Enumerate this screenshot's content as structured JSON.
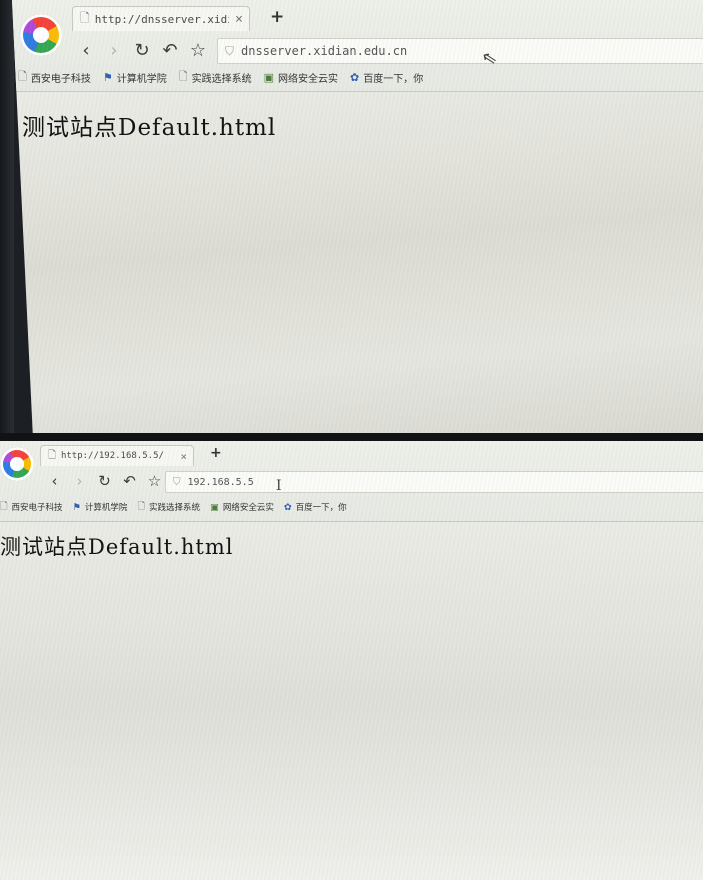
{
  "screenshots": [
    {
      "tab_title": "http://dnsserver.xidian.",
      "address": "dnsserver.xidian.edu.cn",
      "page_text": "测试站点Default.html",
      "cursor_icon": "arrow-cursor-icon"
    },
    {
      "tab_title": "http://192.168.5.5/",
      "address": "192.168.5.5",
      "page_text": "测试站点Default.html",
      "cursor_icon": "text-cursor-icon"
    }
  ],
  "tab_close_glyph": "×",
  "new_tab_glyph": "+",
  "bookmarks": [
    {
      "label": "西安电子科技",
      "icon": "page-icon"
    },
    {
      "label": "计算机学院",
      "icon": "pin-icon"
    },
    {
      "label": "实践选择系统",
      "icon": "page-icon"
    },
    {
      "label": "网络安全云实",
      "icon": "image-icon"
    },
    {
      "label": "百度一下，你",
      "icon": "paw-icon"
    }
  ],
  "colors": {
    "chrome_bg": "#eef0ea",
    "page_bg": "#e8e8e2",
    "text": "#111111"
  }
}
